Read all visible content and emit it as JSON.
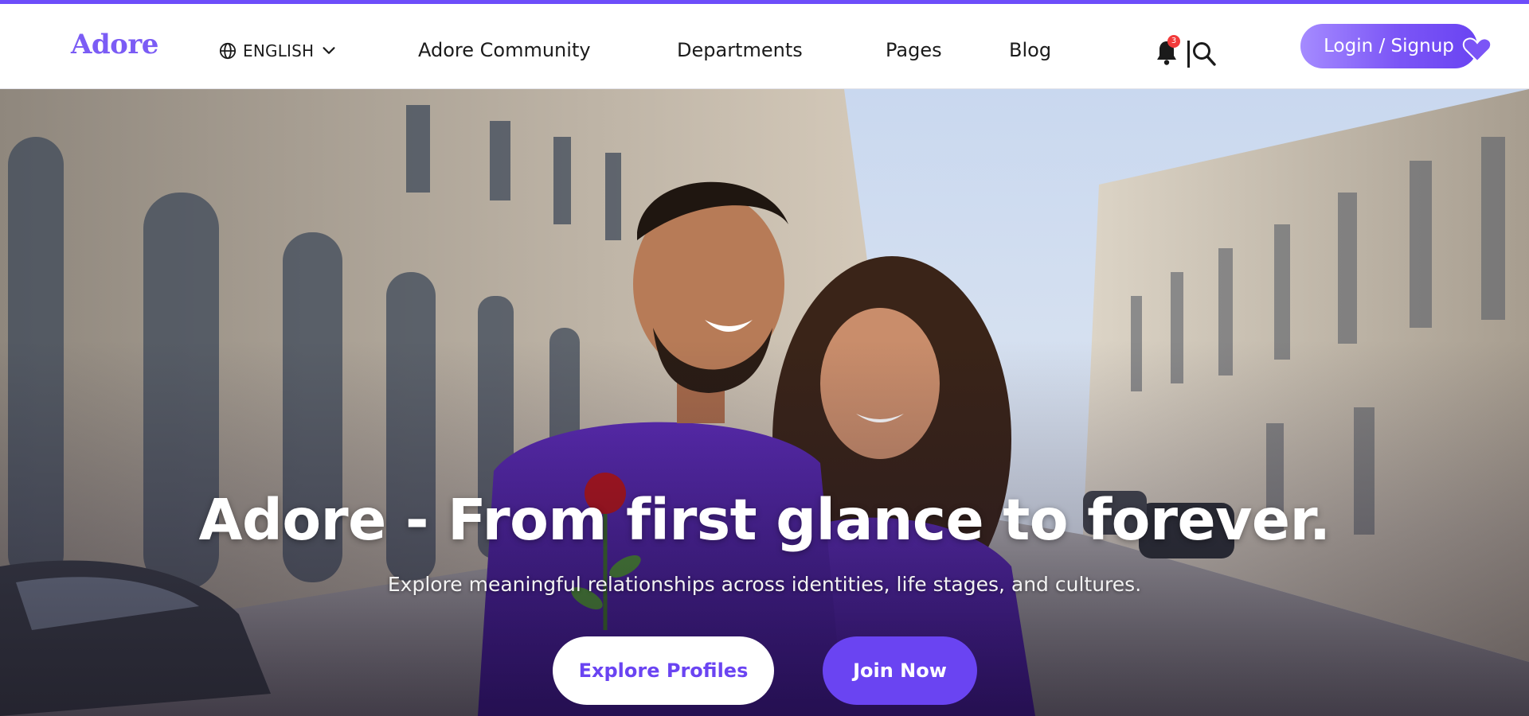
{
  "brand": {
    "logo_text": "Adore",
    "accent_color": "#6d4dfa"
  },
  "header": {
    "language": {
      "icon": "globe-icon",
      "label": "ENGLISH",
      "chevron": "chevron-down-icon"
    },
    "nav": [
      {
        "label": "Adore Community"
      },
      {
        "label": "Departments"
      },
      {
        "label": "Pages"
      },
      {
        "label": "Blog"
      }
    ],
    "notifications": {
      "icon": "bell-icon",
      "count": "3"
    },
    "search": {
      "icon": "search-icon"
    },
    "login_label": "Login / Signup",
    "favorites_icon": "heart-icon"
  },
  "hero": {
    "image": "couple-laughing-on-city-street-photo",
    "headline": "Adore - From first glance to forever.",
    "subheadline": "Explore meaningful relationships across identities, life stages, and cultures.",
    "primary_cta": "Explore Profiles",
    "secondary_cta": "Join Now"
  }
}
